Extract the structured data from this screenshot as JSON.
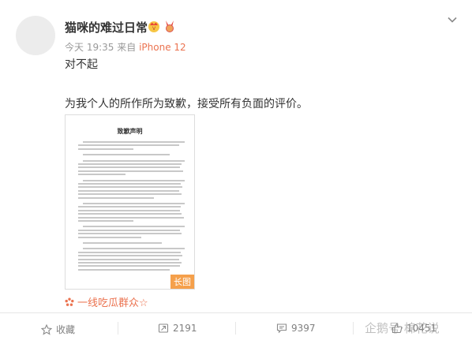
{
  "post": {
    "username": "猫咪的难过日常",
    "time": "今天 19:35",
    "source_prefix": "来自",
    "source": "iPhone 12",
    "text_line1": "对不起",
    "text_line2": "为我个人的所作所为致歉，接受所有负面的评价。",
    "image": {
      "doc_title": "致歉声明",
      "long_label": "长图"
    },
    "topic": "一线吃瓜群众☆"
  },
  "actions": {
    "favorite_label": "收藏",
    "repost_count": "2191",
    "comment_count": "9397",
    "like_count": "10451"
  },
  "watermark": "企鹅号·棉花说",
  "colors": {
    "accent": "#eb7350",
    "long_tag": "#f5a04b",
    "text": "#333333",
    "muted": "#999999"
  },
  "icons": {
    "options": "chevron-down-icon",
    "vip_badge": "vip-crown-icon",
    "medal": "medal-icon",
    "topic": "super-topic-icon",
    "favorite": "star-icon",
    "repost": "repost-icon",
    "comment": "comment-icon",
    "like": "thumbs-up-icon"
  }
}
